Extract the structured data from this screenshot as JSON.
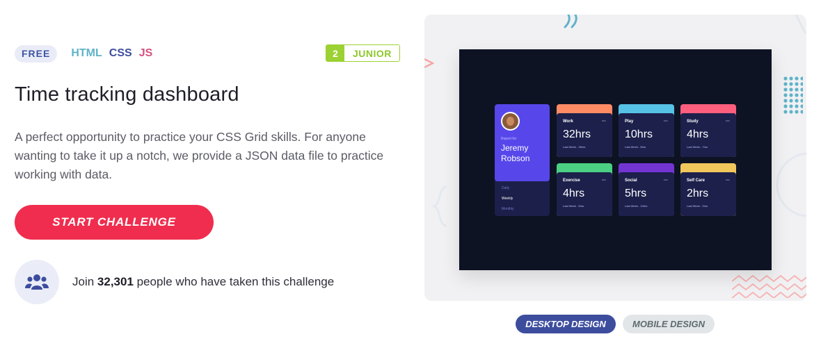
{
  "tags": {
    "free": "FREE",
    "languages": [
      {
        "label": "HTML",
        "color": "#5fb3c9"
      },
      {
        "label": "CSS",
        "color": "#3d4d9e"
      },
      {
        "label": "JS",
        "color": "#d34f7e"
      }
    ]
  },
  "level": {
    "number": "2",
    "name": "JUNIOR",
    "color": "#9bd132"
  },
  "title": "Time tracking dashboard",
  "description": "A perfect opportunity to practice your CSS Grid skills. For anyone wanting to take it up a notch, we provide a JSON data file to practice working with data.",
  "start_button": "START CHALLENGE",
  "join": {
    "prefix": "Join ",
    "count": "32,301",
    "suffix": " people who have taken this challenge",
    "icon": "people-icon"
  },
  "preview": {
    "profile": {
      "report_for": "Report for",
      "name_first": "Jeremy",
      "name_last": "Robson"
    },
    "periods": [
      "Daily",
      "Weekly",
      "Monthly"
    ],
    "active_period": "Weekly",
    "cards": [
      {
        "title": "Work",
        "hours": "32hrs",
        "last": "Last Week - 36hrs",
        "color": "#ff8b64"
      },
      {
        "title": "Play",
        "hours": "10hrs",
        "last": "Last Week - 8hrs",
        "color": "#56c2e6"
      },
      {
        "title": "Study",
        "hours": "4hrs",
        "last": "Last Week - 7hrs",
        "color": "#ff5e7d"
      },
      {
        "title": "Exercise",
        "hours": "4hrs",
        "last": "Last Week - 5hrs",
        "color": "#4bcf83"
      },
      {
        "title": "Social",
        "hours": "5hrs",
        "last": "Last Week - 10hrs",
        "color": "#7335d2"
      },
      {
        "title": "Self Care",
        "hours": "2hrs",
        "last": "Last Week - 2hrs",
        "color": "#f1c75b"
      }
    ]
  },
  "design_toggle": {
    "desktop": "DESKTOP DESIGN",
    "mobile": "MOBILE DESIGN",
    "active": "desktop"
  }
}
